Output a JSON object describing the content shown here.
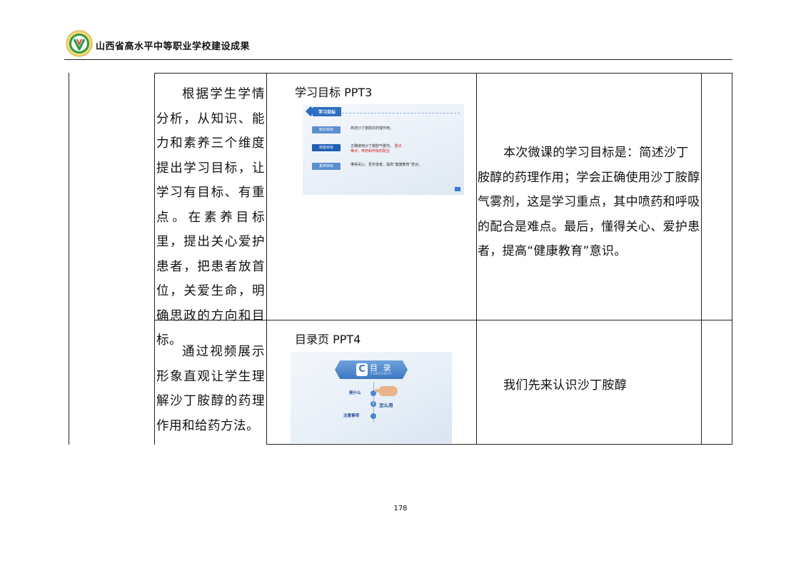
{
  "header": {
    "title": "山西省高水平中等职业学校建设成果"
  },
  "rows": [
    {
      "left_text": "根据学生学情分析，从知识、能力和素养三个维度提出学习目标，让学习有目标、有重点。在素养目标里，提出关心爱护患者，把患者放首位，关爱生命，明确思政的方向和目标。",
      "ppt_label": "学习目标 PPT3",
      "right_text": "本次微课的学习目标是：简述沙丁胺醇的药理作用；学会正确使用沙丁胺醇气雾剂，这是学习重点，其中喷药和呼吸的配合是难点。最后，懂得关心、爱护患者，提高“健康教育”意识。"
    },
    {
      "left_text": "通过视频展示形象直观让学生理解沙丁胺醇的药理作用和给药方法。",
      "ppt_label": "目录页 PPT4",
      "right_text": "我们先来认识沙丁胺醇"
    }
  ],
  "slide1": {
    "header": "学习目标",
    "items": [
      {
        "badge": "知识目标",
        "text": "简述沙丁胺醇的药理作用。"
      },
      {
        "badge": "技能目标",
        "text": "正确使用沙丁胺醇气雾剂。",
        "emphasis": "重点",
        "note": "难点：喷药和呼吸的配合"
      },
      {
        "badge": "素养目标",
        "text": "懂得关心、爱护患者，提高“健康教育”意识。"
      }
    ]
  },
  "slide2": {
    "title": "目 录",
    "subtitle": "CONTENTS",
    "items": [
      {
        "num": "",
        "label": "是什么"
      },
      {
        "num": "2",
        "label": "怎么用"
      },
      {
        "num": "",
        "label": "注意事项"
      }
    ]
  },
  "footer": {
    "page_number": "178"
  },
  "colors": {
    "slide_accent": "#2e6fc0",
    "emphasis_red": "#d62020"
  }
}
